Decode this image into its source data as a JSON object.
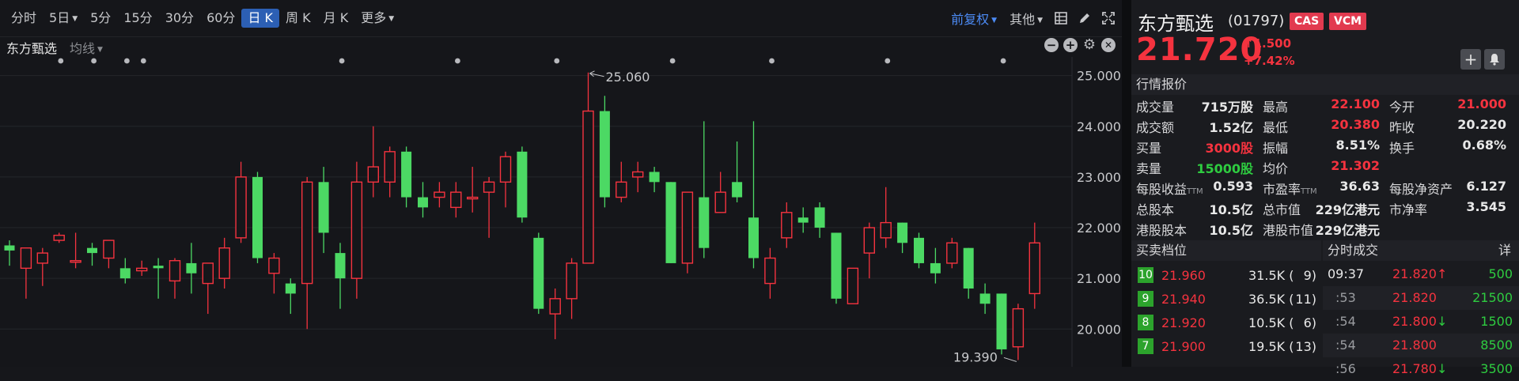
{
  "toolbar": {
    "timeframes": [
      "分时",
      "5日",
      "5分",
      "15分",
      "30分",
      "60分",
      "日 K",
      "周 K",
      "月 K",
      "更多"
    ],
    "adjust": "前复权",
    "other": "其他"
  },
  "subbar": {
    "stock": "东方甄选",
    "indicator": "均线"
  },
  "chart_data": {
    "type": "candlestick",
    "y_ticks": [
      "25.000",
      "24.000",
      "23.000",
      "22.000",
      "21.000",
      "20.000"
    ],
    "ylim": [
      19.35,
      25.15
    ],
    "high_label": "25.060",
    "low_label": "19.390",
    "candles": [
      [
        21.65,
        21.55,
        21.75,
        21.25
      ],
      [
        21.2,
        21.6,
        21.6,
        20.6
      ],
      [
        21.3,
        21.5,
        21.6,
        20.85
      ],
      [
        21.75,
        21.85,
        21.9,
        21.7
      ],
      [
        21.35,
        21.35,
        21.9,
        21.2
      ],
      [
        21.6,
        21.5,
        21.7,
        21.25
      ],
      [
        21.4,
        21.75,
        21.75,
        21.2
      ],
      [
        21.2,
        21.0,
        21.4,
        20.9
      ],
      [
        21.15,
        21.2,
        21.35,
        21.05
      ],
      [
        21.25,
        21.2,
        21.4,
        20.6
      ],
      [
        20.95,
        21.35,
        21.4,
        20.6
      ],
      [
        21.3,
        21.1,
        21.7,
        20.7
      ],
      [
        20.9,
        21.3,
        21.3,
        20.3
      ],
      [
        21.0,
        21.6,
        21.8,
        20.8
      ],
      [
        21.8,
        23.0,
        23.3,
        21.7
      ],
      [
        23.0,
        21.4,
        23.1,
        21.3
      ],
      [
        21.1,
        21.4,
        21.5,
        20.7
      ],
      [
        20.9,
        20.7,
        21.0,
        20.3
      ],
      [
        20.9,
        22.9,
        23.0,
        20.0
      ],
      [
        22.9,
        21.9,
        23.2,
        21.5
      ],
      [
        21.5,
        21.0,
        21.7,
        20.4
      ],
      [
        21.0,
        22.9,
        23.3,
        20.6
      ],
      [
        22.9,
        23.2,
        24.0,
        22.6
      ],
      [
        22.9,
        23.5,
        23.6,
        22.6
      ],
      [
        23.5,
        22.6,
        23.6,
        22.4
      ],
      [
        22.6,
        22.4,
        22.9,
        22.2
      ],
      [
        22.6,
        22.7,
        22.9,
        22.4
      ],
      [
        22.4,
        22.7,
        22.9,
        22.2
      ],
      [
        22.6,
        22.6,
        23.2,
        22.3
      ],
      [
        22.7,
        22.9,
        23.0,
        21.8
      ],
      [
        22.9,
        23.4,
        23.5,
        22.4
      ],
      [
        23.5,
        22.2,
        23.6,
        22.1
      ],
      [
        21.8,
        20.4,
        21.9,
        20.3
      ],
      [
        20.3,
        20.6,
        20.8,
        19.8
      ],
      [
        20.6,
        21.3,
        21.4,
        20.2
      ],
      [
        21.3,
        24.3,
        25.06,
        21.3
      ],
      [
        24.3,
        22.6,
        24.6,
        22.4
      ],
      [
        22.6,
        22.9,
        23.3,
        22.5
      ],
      [
        23.0,
        23.1,
        23.3,
        22.7
      ],
      [
        23.1,
        22.9,
        23.2,
        22.7
      ],
      [
        22.9,
        21.3,
        22.9,
        21.3
      ],
      [
        21.3,
        22.7,
        22.7,
        21.1
      ],
      [
        22.6,
        21.6,
        24.1,
        21.4
      ],
      [
        22.3,
        22.7,
        23.1,
        22.3
      ],
      [
        22.9,
        22.6,
        23.7,
        22.5
      ],
      [
        22.2,
        21.4,
        24.1,
        21.2
      ],
      [
        20.9,
        21.4,
        21.6,
        20.6
      ],
      [
        21.8,
        22.3,
        22.5,
        21.6
      ],
      [
        22.2,
        22.1,
        22.4,
        21.9
      ],
      [
        22.4,
        22.0,
        22.5,
        21.8
      ],
      [
        21.9,
        20.6,
        21.9,
        20.5
      ],
      [
        20.5,
        21.2,
        21.2,
        20.5
      ],
      [
        21.5,
        22.0,
        22.1,
        21.0
      ],
      [
        21.8,
        22.1,
        22.8,
        21.6
      ],
      [
        22.1,
        21.7,
        22.1,
        21.5
      ],
      [
        21.8,
        21.3,
        21.9,
        21.2
      ],
      [
        21.3,
        21.1,
        21.6,
        20.9
      ],
      [
        21.3,
        21.7,
        21.8,
        21.2
      ],
      [
        21.6,
        20.8,
        21.6,
        20.6
      ],
      [
        20.7,
        20.5,
        20.9,
        20.3
      ],
      [
        20.7,
        19.6,
        20.7,
        19.5
      ],
      [
        19.65,
        20.4,
        20.5,
        19.39
      ],
      [
        20.7,
        21.7,
        22.1,
        20.4
      ]
    ],
    "event_dots": 15
  },
  "quote": {
    "name": "东方甄选",
    "code": "(01797)",
    "badges": [
      "CAS",
      "VCM"
    ],
    "price": "21.720",
    "change": "1.500",
    "change_pct": "+7.42%"
  },
  "market": {
    "title": "行情报价",
    "rows": [
      [
        {
          "label": "成交量",
          "value": "715万股",
          "color": "white"
        },
        {
          "label": "最高",
          "value": "22.100",
          "color": "red"
        },
        {
          "label": "今开",
          "value": "21.000",
          "color": "red"
        }
      ],
      [
        {
          "label": "成交额",
          "value": "1.52亿",
          "color": "white"
        },
        {
          "label": "最低",
          "value": "20.380",
          "color": "red"
        },
        {
          "label": "昨收",
          "value": "20.220",
          "color": "white"
        }
      ],
      [
        {
          "label": "买量",
          "value": "3000股",
          "color": "red"
        },
        {
          "label": "振幅",
          "value": "8.51%",
          "color": "white"
        },
        {
          "label": "换手",
          "value": "0.68%",
          "color": "white"
        }
      ],
      [
        {
          "label": "卖量",
          "value": "15000股",
          "color": "green"
        },
        {
          "label": "均价",
          "value": "21.302",
          "color": "red"
        },
        {
          "label": "",
          "value": "",
          "color": "white"
        }
      ]
    ],
    "rows2": [
      [
        {
          "label": "每股收益",
          "sup": "TTM",
          "value": "0.593"
        },
        {
          "label": "市盈率",
          "sup": "TTM",
          "value": "36.63"
        },
        {
          "label": "每股净资产",
          "sup": "",
          "value": "6.127"
        }
      ],
      [
        {
          "label": "总股本",
          "sup": "",
          "value": "10.5亿"
        },
        {
          "label": "总市值",
          "sup": "",
          "value": "229亿港元"
        },
        {
          "label": "市净率",
          "sup": "",
          "value": "3.545"
        }
      ],
      [
        {
          "label": "港股股本",
          "sup": "",
          "value": "10.5亿"
        },
        {
          "label": "港股市值",
          "sup": "",
          "value": "229亿港元"
        },
        {
          "label": "",
          "sup": "",
          "value": ""
        }
      ]
    ]
  },
  "orderbook": {
    "title": "买卖档位",
    "levels": [
      {
        "level": "10",
        "price": "21.960",
        "vol": "31.5K",
        "count": "9"
      },
      {
        "level": "9",
        "price": "21.940",
        "vol": "36.5K",
        "count": "11"
      },
      {
        "level": "8",
        "price": "21.920",
        "vol": "10.5K",
        "count": "6"
      },
      {
        "level": "7",
        "price": "21.900",
        "vol": "19.5K",
        "count": "13"
      }
    ]
  },
  "trades": {
    "title": "分时成交",
    "detail": "详",
    "rows": [
      {
        "time": "09:37",
        "price": "21.820",
        "dir": "up",
        "vol": "500",
        "vol_color": "green"
      },
      {
        "time": ":53",
        "price": "21.820",
        "dir": "",
        "vol": "21500",
        "vol_color": "green"
      },
      {
        "time": ":54",
        "price": "21.800",
        "dir": "down",
        "vol": "1500",
        "vol_color": "green"
      },
      {
        "time": ":54",
        "price": "21.800",
        "dir": "",
        "vol": "8500",
        "vol_color": "green"
      },
      {
        "time": ":56",
        "price": "21.780",
        "dir": "down",
        "vol": "3500",
        "vol_color": "green"
      }
    ]
  }
}
